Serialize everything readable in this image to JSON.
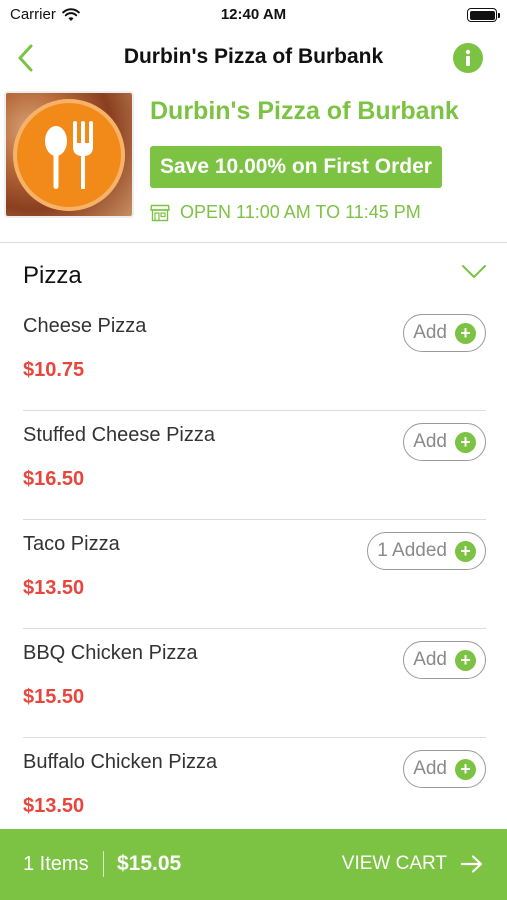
{
  "status_bar": {
    "carrier": "Carrier",
    "time": "12:40 AM"
  },
  "nav": {
    "title": "Durbin's Pizza of Burbank"
  },
  "restaurant": {
    "name": "Durbin's Pizza of Burbank",
    "promo": "Save 10.00% on First Order",
    "hours": "OPEN 11:00 AM TO 11:45 PM"
  },
  "category": {
    "title": "Pizza"
  },
  "menu_items": [
    {
      "name": "Cheese Pizza",
      "price": "$10.75",
      "button": "Add"
    },
    {
      "name": "Stuffed Cheese Pizza",
      "price": "$16.50",
      "button": "Add"
    },
    {
      "name": "Taco Pizza",
      "price": "$13.50",
      "button": "1 Added"
    },
    {
      "name": "BBQ Chicken Pizza",
      "price": "$15.50",
      "button": "Add"
    },
    {
      "name": "Buffalo Chicken Pizza",
      "price": "$13.50",
      "button": "Add"
    }
  ],
  "cart": {
    "items": "1 Items",
    "total": "$15.05",
    "action": "VIEW CART"
  },
  "colors": {
    "accent": "#7cc243",
    "price": "#e8453c",
    "logo": "#f28a1a"
  },
  "icons": [
    "wifi-icon",
    "battery-icon",
    "back-chevron-icon",
    "info-icon",
    "restaurant-logo",
    "store-icon",
    "chevron-down-icon",
    "plus-circle-icon",
    "arrow-right-icon"
  ]
}
